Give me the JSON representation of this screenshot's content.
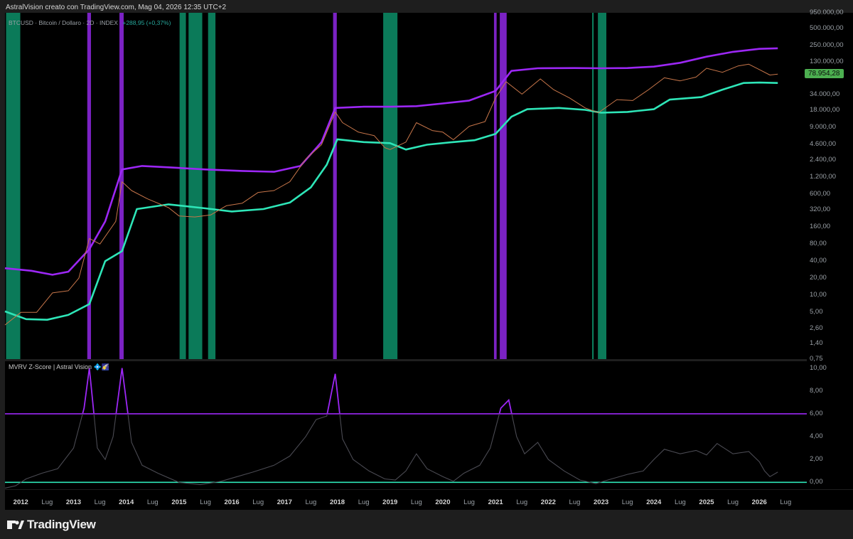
{
  "header": {
    "attribution": "AstralVision creato con TradingView.com, Mag 04, 2026 12:35 UTC+2"
  },
  "main_pane": {
    "symbol_line": "BTCUSD · Bitcoin / Dollaro · 2D · INDEX",
    "change": "+288,95 (+0,37%)",
    "last_price_badge": "78.954,28",
    "badge_color": "#4caf50"
  },
  "sub_pane": {
    "indicator_name": "MVRV Z-Score | Astral Vision 💠🌠"
  },
  "brand": {
    "name": "TradingView"
  },
  "colors": {
    "background": "#000000",
    "frame": "#1e1e1e",
    "upper_band": "#9c27f5",
    "lower_band": "#2ee6b8",
    "zone_green": "#0b7a59",
    "zone_purple": "#7b22c4",
    "price": "#c8764a",
    "zscore": "#4a4a52"
  },
  "chart_data": [
    {
      "type": "line",
      "title": "BTCUSD · Bitcoin / Dollaro · 2D · INDEX",
      "yscale": "log",
      "ylim": [
        0.75,
        950000
      ],
      "yticks": [
        "950.000,00",
        "500.000,00",
        "250.000,00",
        "130.000,00",
        "34.000,00",
        "18.000,00",
        "9.000,00",
        "4.600,00",
        "2.400,00",
        "1.200,00",
        "600,00",
        "320,00",
        "160,00",
        "80,00",
        "40,00",
        "20,00",
        "10,00",
        "5,00",
        "2,60",
        "1,40",
        "0,75"
      ],
      "xlim": [
        2011.7,
        2026.9
      ],
      "series": [
        {
          "x": [
            2011.7,
            2012.0,
            2012.3,
            2012.6,
            2012.9,
            2013.1,
            2013.3,
            2013.5,
            2013.8,
            2013.92,
            2014.1,
            2014.4,
            2014.8,
            2015.0,
            2015.3,
            2015.6,
            2015.9,
            2016.2,
            2016.5,
            2016.8,
            2017.1,
            2017.4,
            2017.7,
            2017.96,
            2018.1,
            2018.4,
            2018.7,
            2018.9,
            2019.0,
            2019.3,
            2019.5,
            2019.8,
            2020.0,
            2020.2,
            2020.5,
            2020.8,
            2021.0,
            2021.2,
            2021.5,
            2021.85,
            2022.1,
            2022.4,
            2022.7,
            2022.95,
            2023.3,
            2023.6,
            2023.9,
            2024.2,
            2024.5,
            2024.8,
            2025.0,
            2025.3,
            2025.6,
            2025.8,
            2026.0,
            2026.2,
            2026.35
          ],
          "y": [
            3,
            5,
            5,
            11,
            12,
            20,
            100,
            80,
            200,
            1000,
            700,
            500,
            350,
            250,
            240,
            260,
            380,
            420,
            650,
            700,
            1000,
            2500,
            4500,
            17000,
            11000,
            7500,
            6500,
            4000,
            3700,
            5000,
            11000,
            8000,
            7500,
            5500,
            9500,
            11500,
            30000,
            58000,
            35000,
            65000,
            42000,
            30000,
            20000,
            16500,
            28000,
            27000,
            42000,
            68000,
            60000,
            70000,
            100000,
            85000,
            110000,
            118000,
            95000,
            76000,
            79000
          ]
        },
        {
          "x": [
            2011.7,
            2012.2,
            2012.6,
            2012.9,
            2013.3,
            2013.6,
            2013.92,
            2014.3,
            2014.8,
            2015.5,
            2016.2,
            2016.8,
            2017.3,
            2017.7,
            2017.96,
            2018.5,
            2019.0,
            2019.5,
            2020.0,
            2020.5,
            2021.0,
            2021.3,
            2021.8,
            2022.5,
            2023.0,
            2023.5,
            2024.0,
            2024.5,
            2025.0,
            2025.5,
            2026.0,
            2026.35
          ],
          "y": [
            30,
            27,
            23,
            26,
            65,
            200,
            1650,
            1900,
            1800,
            1650,
            1550,
            1500,
            1900,
            5000,
            20000,
            21000,
            21000,
            21500,
            24000,
            27000,
            40000,
            90000,
            100000,
            101000,
            100000,
            101000,
            107000,
            125000,
            160000,
            195000,
            220000,
            225000
          ]
        },
        {
          "x": [
            2011.7,
            2012.1,
            2012.5,
            2012.9,
            2013.3,
            2013.6,
            2013.92,
            2014.2,
            2014.8,
            2015.5,
            2016.0,
            2016.6,
            2017.1,
            2017.5,
            2017.8,
            2018.0,
            2018.5,
            2019.0,
            2019.3,
            2019.7,
            2020.2,
            2020.6,
            2021.0,
            2021.3,
            2021.6,
            2022.2,
            2022.7,
            2023.0,
            2023.5,
            2024.0,
            2024.3,
            2024.9,
            2025.3,
            2025.7,
            2026.0,
            2026.35
          ],
          "y": [
            5.2,
            3.8,
            3.7,
            4.5,
            7,
            40,
            60,
            330,
            400,
            340,
            300,
            330,
            430,
            800,
            2000,
            5600,
            5000,
            4800,
            3700,
            4500,
            5000,
            5400,
            7000,
            14000,
            19000,
            20000,
            18500,
            16500,
            17000,
            19000,
            28000,
            31000,
            42000,
            55000,
            56000,
            55000
          ]
        }
      ],
      "zones": [
        {
          "color": "green",
          "x": [
            2011.72,
            2011.99
          ]
        },
        {
          "color": "purple",
          "x": [
            2013.26,
            2013.33
          ]
        },
        {
          "color": "purple",
          "x": [
            2013.87,
            2013.95
          ]
        },
        {
          "color": "green",
          "x": [
            2015.01,
            2015.13
          ]
        },
        {
          "color": "green",
          "x": [
            2015.18,
            2015.44
          ]
        },
        {
          "color": "green",
          "x": [
            2015.55,
            2015.69
          ]
        },
        {
          "color": "purple",
          "x": [
            2017.92,
            2017.99
          ]
        },
        {
          "color": "green",
          "x": [
            2018.87,
            2019.14
          ]
        },
        {
          "color": "purple",
          "x": [
            2020.97,
            2021.02
          ]
        },
        {
          "color": "purple",
          "x": [
            2021.08,
            2021.21
          ]
        },
        {
          "color": "green",
          "x": [
            2022.83,
            2022.86
          ]
        },
        {
          "color": "green",
          "x": [
            2022.94,
            2023.1
          ]
        }
      ]
    },
    {
      "type": "line",
      "title": "MVRV Z-Score | Astral Vision 💠🌠",
      "ylim": [
        -0.6,
        10.6
      ],
      "yticks": [
        "10,00",
        "8,00",
        "6,00",
        "4,00",
        "2,00",
        "0,00"
      ],
      "thresholds": {
        "upper": 6.0,
        "lower": 0.0
      },
      "series": [
        {
          "x": [
            2011.7,
            2011.9,
            2012.1,
            2012.4,
            2012.7,
            2013.0,
            2013.2,
            2013.3,
            2013.45,
            2013.6,
            2013.75,
            2013.92,
            2014.1,
            2014.3,
            2014.6,
            2015.0,
            2015.4,
            2015.8,
            2016.1,
            2016.4,
            2016.8,
            2017.1,
            2017.4,
            2017.6,
            2017.8,
            2017.96,
            2018.1,
            2018.3,
            2018.6,
            2018.9,
            2019.1,
            2019.3,
            2019.5,
            2019.7,
            2020.0,
            2020.2,
            2020.4,
            2020.7,
            2020.9,
            2021.1,
            2021.25,
            2021.4,
            2021.55,
            2021.8,
            2022.0,
            2022.3,
            2022.6,
            2022.9,
            2023.2,
            2023.5,
            2023.8,
            2024.0,
            2024.2,
            2024.5,
            2024.8,
            2025.0,
            2025.2,
            2025.5,
            2025.8,
            2026.0,
            2026.1,
            2026.2,
            2026.35
          ],
          "y": [
            -0.5,
            -0.3,
            0.3,
            0.8,
            1.2,
            3.0,
            6.5,
            10.0,
            3.0,
            2.0,
            4.0,
            10.0,
            3.5,
            1.5,
            0.8,
            0.0,
            -0.2,
            0.1,
            0.5,
            0.9,
            1.5,
            2.3,
            4.0,
            5.5,
            5.8,
            9.5,
            3.8,
            2.0,
            1.0,
            0.3,
            0.2,
            1.0,
            2.5,
            1.2,
            0.5,
            0.1,
            0.8,
            1.5,
            3.0,
            6.5,
            7.2,
            4.0,
            2.5,
            3.5,
            2.0,
            1.0,
            0.2,
            -0.1,
            0.3,
            0.7,
            1.0,
            2.0,
            2.9,
            2.5,
            2.8,
            2.4,
            3.4,
            2.5,
            2.7,
            1.8,
            1.0,
            0.5,
            0.9
          ]
        }
      ]
    }
  ],
  "x_axis": {
    "ticks": [
      {
        "x": 2012.0,
        "label": "2012",
        "year": true
      },
      {
        "x": 2012.5,
        "label": "Lug",
        "year": false
      },
      {
        "x": 2013.0,
        "label": "2013",
        "year": true
      },
      {
        "x": 2013.5,
        "label": "Lug",
        "year": false
      },
      {
        "x": 2014.0,
        "label": "2014",
        "year": true
      },
      {
        "x": 2014.5,
        "label": "Lug",
        "year": false
      },
      {
        "x": 2015.0,
        "label": "2015",
        "year": true
      },
      {
        "x": 2015.5,
        "label": "Lug",
        "year": false
      },
      {
        "x": 2016.0,
        "label": "2016",
        "year": true
      },
      {
        "x": 2016.5,
        "label": "Lug",
        "year": false
      },
      {
        "x": 2017.0,
        "label": "2017",
        "year": true
      },
      {
        "x": 2017.5,
        "label": "Lug",
        "year": false
      },
      {
        "x": 2018.0,
        "label": "2018",
        "year": true
      },
      {
        "x": 2018.5,
        "label": "Lug",
        "year": false
      },
      {
        "x": 2019.0,
        "label": "2019",
        "year": true
      },
      {
        "x": 2019.5,
        "label": "Lug",
        "year": false
      },
      {
        "x": 2020.0,
        "label": "2020",
        "year": true
      },
      {
        "x": 2020.5,
        "label": "Lug",
        "year": false
      },
      {
        "x": 2021.0,
        "label": "2021",
        "year": true
      },
      {
        "x": 2021.5,
        "label": "Lug",
        "year": false
      },
      {
        "x": 2022.0,
        "label": "2022",
        "year": true
      },
      {
        "x": 2022.5,
        "label": "Lug",
        "year": false
      },
      {
        "x": 2023.0,
        "label": "2023",
        "year": true
      },
      {
        "x": 2023.5,
        "label": "Lug",
        "year": false
      },
      {
        "x": 2024.0,
        "label": "2024",
        "year": true
      },
      {
        "x": 2024.5,
        "label": "Lug",
        "year": false
      },
      {
        "x": 2025.0,
        "label": "2025",
        "year": true
      },
      {
        "x": 2025.5,
        "label": "Lug",
        "year": false
      },
      {
        "x": 2026.0,
        "label": "2026",
        "year": true
      },
      {
        "x": 2026.5,
        "label": "Lug",
        "year": false
      }
    ]
  }
}
